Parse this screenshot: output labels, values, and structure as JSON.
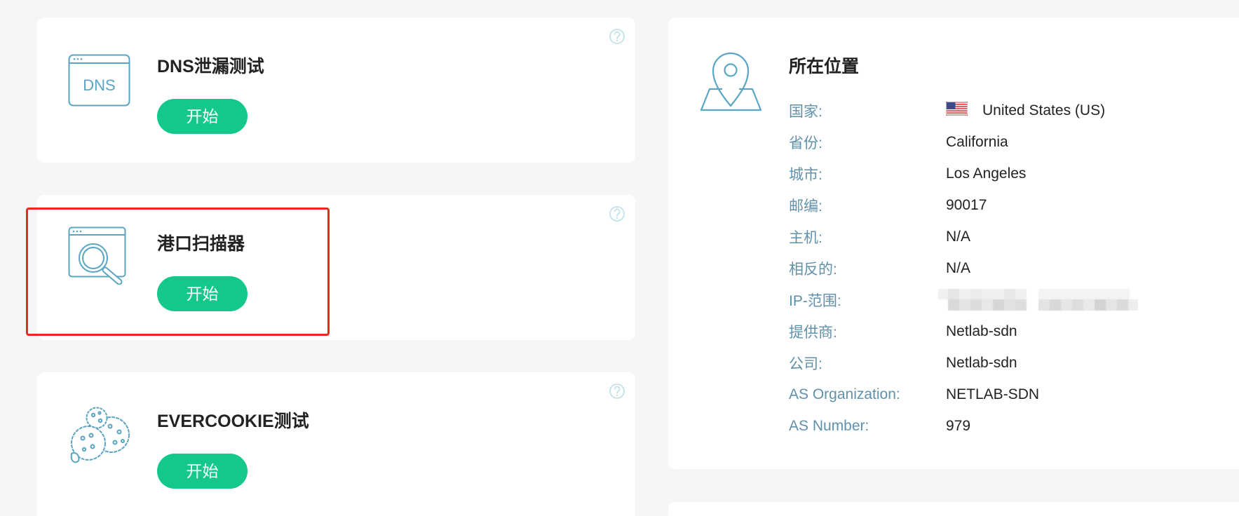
{
  "colors": {
    "background": "#f6f6f6",
    "card": "#ffffff",
    "accent": "#14c88b",
    "icon": "#5aa5c3",
    "help_icon": "#c3e2ec",
    "label": "#5f91ab",
    "value": "#222222",
    "highlight": "#e52a1f"
  },
  "tools": [
    {
      "title": "DNS泄漏测试",
      "button_label": "开始",
      "icon": "dns-window-icon",
      "icon_text": "DNS",
      "help_icon": "help-icon"
    },
    {
      "title": "港口扫描器",
      "button_label": "开始",
      "icon": "search-window-icon",
      "help_icon": "help-icon",
      "highlighted": true
    },
    {
      "title": "EVERCOOKIE测试",
      "button_label": "开始",
      "icon": "cookies-icon",
      "help_icon": "help-icon"
    }
  ],
  "location": {
    "title": "所在位置",
    "icon": "location-pin-icon",
    "rows": [
      {
        "label": "国家:",
        "value": "United States (US)",
        "icon": "us-flag-icon"
      },
      {
        "label": "省份:",
        "value": "California"
      },
      {
        "label": "城市:",
        "value": "Los Angeles"
      },
      {
        "label": "邮编:",
        "value": "90017"
      },
      {
        "label": "主机:",
        "value": "N/A"
      },
      {
        "label": "相反的:",
        "value": "N/A"
      },
      {
        "label": "IP-范围:",
        "value_obscured": true
      },
      {
        "label": "提供商:",
        "value": "Netlab-sdn"
      },
      {
        "label": "公司:",
        "value": "Netlab-sdn"
      },
      {
        "label": "AS Organization:",
        "value": "NETLAB-SDN"
      },
      {
        "label": "AS Number:",
        "value": "979"
      }
    ]
  }
}
